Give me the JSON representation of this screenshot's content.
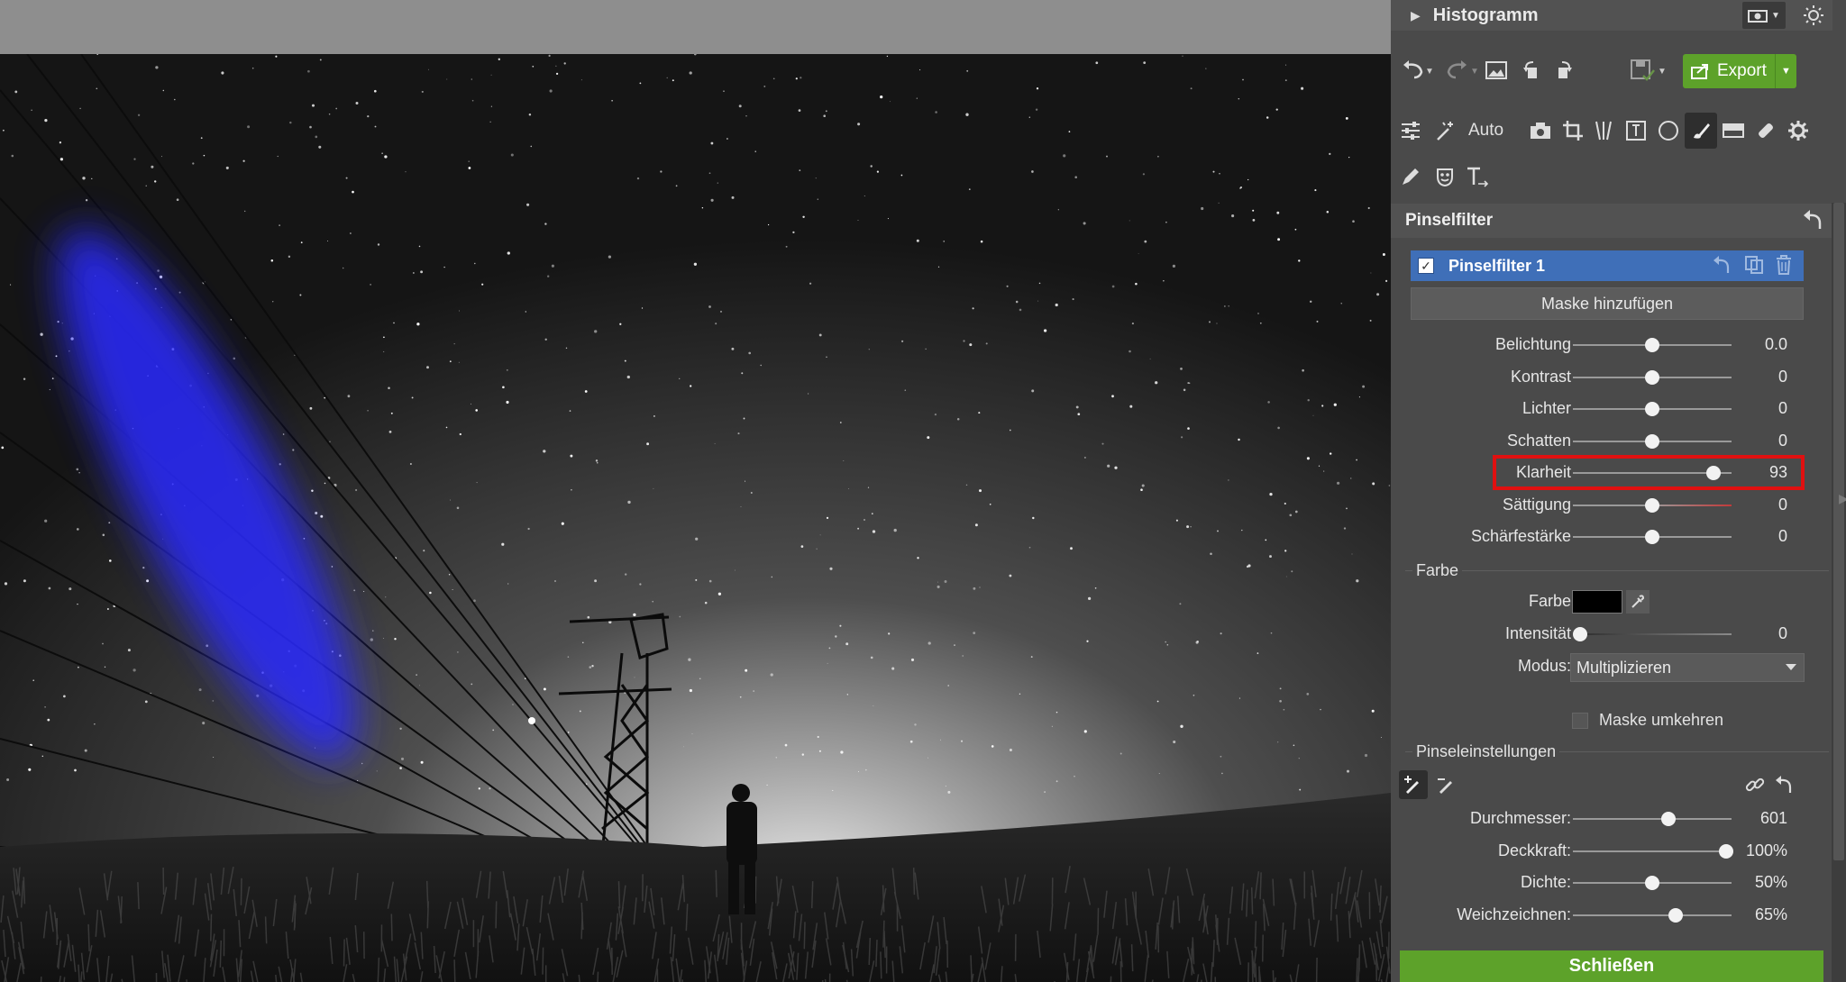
{
  "histogram": {
    "title": "Histogramm"
  },
  "toolbar": {
    "export_label": "Export",
    "auto_label": "Auto"
  },
  "section": {
    "title": "Pinselfilter"
  },
  "filter": {
    "name": "Pinselfilter 1",
    "checked": true,
    "add_mask_label": "Maske hinzufügen"
  },
  "adjustments": [
    {
      "label": "Belichtung",
      "value": "0.0",
      "level": 0.5
    },
    {
      "label": "Kontrast",
      "value": "0",
      "level": 0.5
    },
    {
      "label": "Lichter",
      "value": "0",
      "level": 0.5
    },
    {
      "label": "Schatten",
      "value": "0",
      "level": 0.5
    },
    {
      "label": "Klarheit",
      "value": "93",
      "level": 0.93,
      "highlighted": true
    },
    {
      "label": "Sättigung",
      "value": "0",
      "level": 0.5
    },
    {
      "label": "Schärfestärke",
      "value": "0",
      "level": 0.5
    }
  ],
  "color": {
    "group_label": "Farbe",
    "color_label": "Farbe",
    "swatch_color": "#000000",
    "intensity_label": "Intensität",
    "intensity_value": "0",
    "intensity_level": 0,
    "mode_label": "Modus:",
    "mode_value": "Multiplizieren",
    "invert_label": "Maske umkehren"
  },
  "brush": {
    "group_label": "Pinseleinstellungen",
    "settings": [
      {
        "label": "Durchmesser:",
        "value": "601",
        "level": 0.6
      },
      {
        "label": "Deckkraft:",
        "value": "100%",
        "level": 1.0
      },
      {
        "label": "Dichte:",
        "value": "50%",
        "level": 0.5
      },
      {
        "label": "Weichzeichnen:",
        "value": "65%",
        "level": 0.65
      }
    ]
  },
  "close_label": "Schließen",
  "colors": {
    "accent_green": "#5da22a",
    "selection_blue": "#3f6fb8",
    "highlight_red": "#e01010",
    "mask_overlay": "#2a2aff"
  }
}
